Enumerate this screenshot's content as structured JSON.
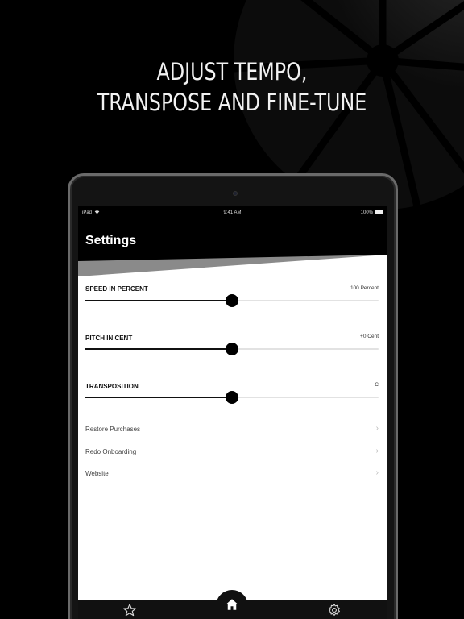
{
  "headline": {
    "line1": "ADJUST TEMPO,",
    "line2": "TRANSPOSE AND FINE-TUNE"
  },
  "status_bar": {
    "device": "iPad",
    "time": "9:41 AM",
    "battery": "100%"
  },
  "screen": {
    "title": "Settings"
  },
  "settings": [
    {
      "label": "SPEED IN PERCENT",
      "value_text": "100 Percent",
      "level": 0.5
    },
    {
      "label": "PITCH IN CENT",
      "value_text": "+0 Cent",
      "level": 0.5
    },
    {
      "label": "TRANSPOSITION",
      "value_text": "C",
      "level": 0.5
    }
  ],
  "menu": [
    {
      "label": "Restore Purchases"
    },
    {
      "label": "Redo Onboarding"
    },
    {
      "label": "Website"
    }
  ],
  "tabs": {
    "left_icon": "star-icon",
    "center_icon": "home-icon",
    "right_icon": "gear-icon"
  },
  "colors": {
    "background": "#000000",
    "panel": "#ffffff",
    "accent": "#111111",
    "track": "#e2e2e2"
  }
}
